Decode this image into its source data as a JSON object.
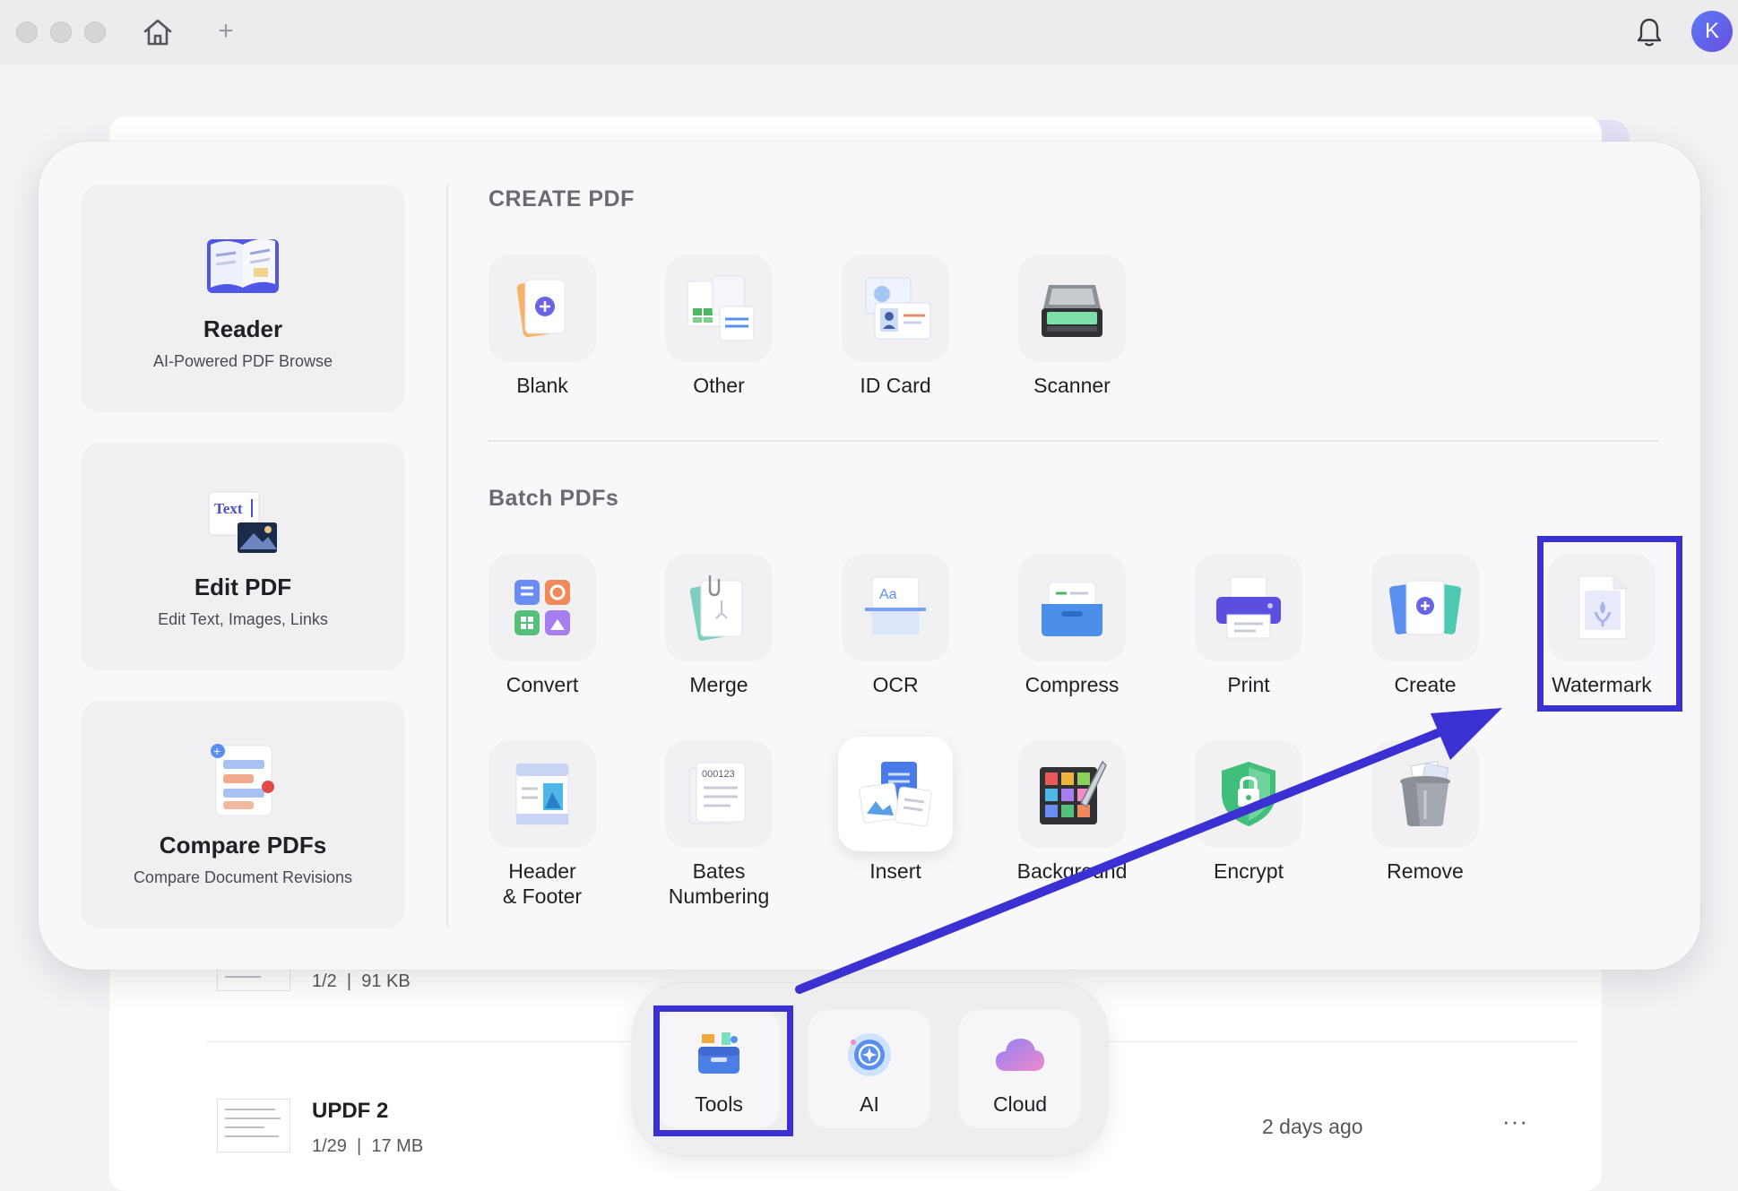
{
  "titlebar": {
    "avatar_initial": "K",
    "new_tab_symbol": "+"
  },
  "tools_panel": {
    "side_cards": [
      {
        "title": "Reader",
        "subtitle": "AI-Powered PDF Browse"
      },
      {
        "title": "Edit PDF",
        "subtitle": "Edit Text, Images, Links",
        "icon_text": "Text"
      },
      {
        "title": "Compare PDFs",
        "subtitle": "Compare Document Revisions"
      }
    ],
    "create_pdf": {
      "title": "CREATE PDF",
      "tools": [
        {
          "label": "Blank",
          "icon": "blank-icon"
        },
        {
          "label": "Other",
          "icon": "other-icon"
        },
        {
          "label": "ID Card",
          "icon": "id-card-icon"
        },
        {
          "label": "Scanner",
          "icon": "scanner-icon"
        }
      ]
    },
    "batch_pdfs": {
      "title": "Batch PDFs",
      "tools": [
        {
          "label": "Convert",
          "icon": "convert-icon"
        },
        {
          "label": "Merge",
          "icon": "merge-icon"
        },
        {
          "label": "OCR",
          "icon": "ocr-icon",
          "icon_text": "Aa"
        },
        {
          "label": "Compress",
          "icon": "compress-icon"
        },
        {
          "label": "Print",
          "icon": "print-icon"
        },
        {
          "label": "Create",
          "icon": "create-icon"
        },
        {
          "label": "Watermark",
          "icon": "watermark-icon"
        },
        {
          "label": "Header\n& Footer",
          "icon": "header-footer-icon"
        },
        {
          "label": "Bates\nNumbering",
          "icon": "bates-numbering-icon",
          "icon_text": "000123"
        },
        {
          "label": "Insert",
          "icon": "insert-icon"
        },
        {
          "label": "Background",
          "icon": "background-icon"
        },
        {
          "label": "Encrypt",
          "icon": "encrypt-icon"
        },
        {
          "label": "Remove",
          "icon": "remove-icon"
        }
      ]
    }
  },
  "dock": {
    "items": [
      {
        "label": "Tools",
        "icon": "tools-icon"
      },
      {
        "label": "AI",
        "icon": "ai-icon"
      },
      {
        "label": "Cloud",
        "icon": "cloud-icon"
      }
    ]
  },
  "file_list": {
    "rows": [
      {
        "name": "",
        "pages": "1/2",
        "size": "91 KB",
        "date": ""
      },
      {
        "name": "UPDF 2",
        "pages": "1/29",
        "size": "17 MB",
        "date": "2 days ago",
        "more": "···"
      }
    ]
  },
  "annotation": {
    "highlight_color": "#3b30d1"
  },
  "colors": {
    "accent": "#6f63ee",
    "panel_bg": "#f8f8fa",
    "tile_bg": "#f1f1f4"
  }
}
